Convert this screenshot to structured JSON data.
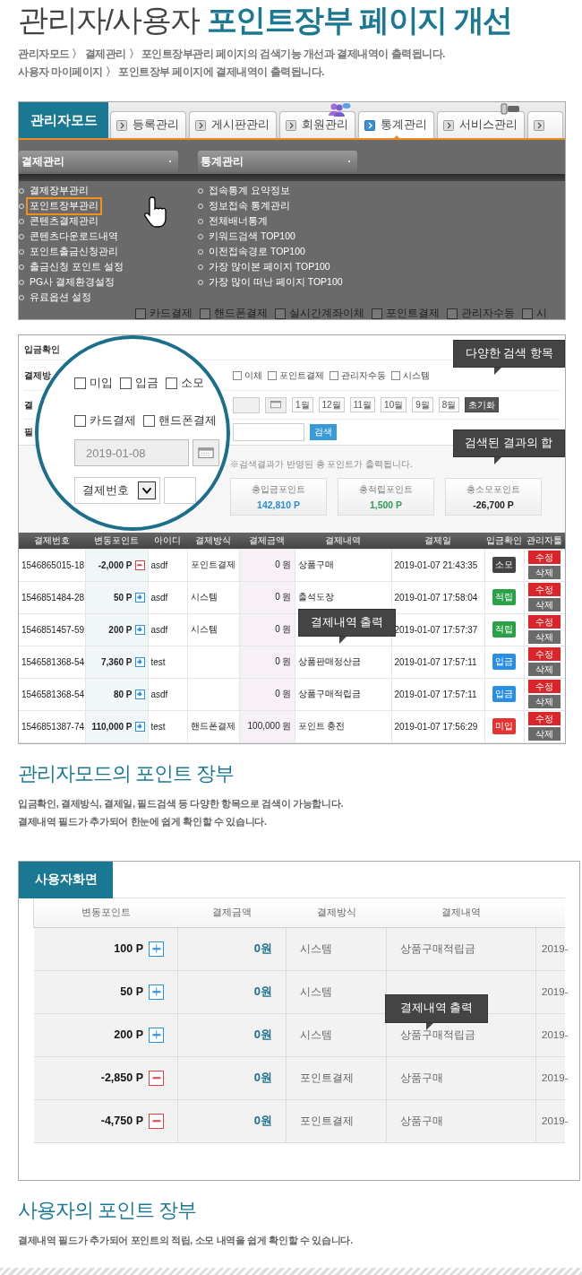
{
  "header": {
    "title_plain": "관리자/사용자",
    "title_highlight": "포인트장부 페이지 개선",
    "lines": [
      "관리자모드 〉  결제관리 〉 포인트장부관리 페이지의 검색기능 개선과 결제내역이 출력됩니다.",
      "사용자 마이페이지 〉 포인트장부 페이지에 결제내역이 출력됩니다."
    ]
  },
  "admin_menu_shot": {
    "badge": "관리자모드",
    "tabs": [
      {
        "label": "등록관리",
        "selected": false
      },
      {
        "label": "게시판관리",
        "selected": false
      },
      {
        "label": "회원관리",
        "selected": false
      },
      {
        "label": "통계관리",
        "selected": true
      },
      {
        "label": "서비스관리",
        "selected": false
      },
      {
        "selected": false
      }
    ],
    "menus": [
      {
        "title": "결제관리",
        "items": [
          {
            "label": "결제장부관리",
            "highlighted": false
          },
          {
            "label": "포인트장부관리",
            "highlighted": true
          },
          {
            "label": "콘텐츠결제관리",
            "highlighted": false
          },
          {
            "label": "콘텐츠다운로드내역",
            "highlighted": false
          },
          {
            "label": "포인트출금신청관리",
            "highlighted": false
          },
          {
            "label": "출금신청 포인트 설정",
            "highlighted": false
          },
          {
            "label": "PG사 결제환경설정",
            "highlighted": false
          },
          {
            "label": "유료옵션 설정",
            "highlighted": false
          }
        ]
      },
      {
        "title": "통계관리",
        "items": [
          {
            "label": "접속통계 요약정보",
            "highlighted": false
          },
          {
            "label": "정보접속 통계관리",
            "highlighted": false
          },
          {
            "label": "전체배너통계",
            "highlighted": false
          },
          {
            "label": "키워드검색 TOP100",
            "highlighted": false
          },
          {
            "label": "이전접속경로 TOP100",
            "highlighted": false
          },
          {
            "label": "가장 많이본 페이지 TOP100",
            "highlighted": false
          },
          {
            "label": "가장 많이 떠난 페이지 TOP100",
            "highlighted": false
          }
        ]
      }
    ],
    "background_checkboxes": [
      {
        "label": "카드결제",
        "checked": false
      },
      {
        "label": "핸드폰결제",
        "checked": false
      },
      {
        "label": "실시간계좌이체",
        "checked": false
      },
      {
        "label": "포인트결제",
        "checked": false
      },
      {
        "label": "관리자수동",
        "checked": false
      },
      {
        "label": "시",
        "checked": false
      }
    ]
  },
  "filter_shot": {
    "labels": [
      "입금확인",
      "결제방",
      "결",
      "필"
    ],
    "payment_checkboxes": [
      {
        "label": "이체",
        "checked": false
      },
      {
        "label": "포인트결제",
        "checked": false
      },
      {
        "label": "관리자수동",
        "checked": false
      },
      {
        "label": "시스템",
        "checked": false
      }
    ],
    "month_buttons": [
      {
        "label": "1월",
        "kind": "month"
      },
      {
        "label": "12월",
        "kind": "month"
      },
      {
        "label": "11월",
        "kind": "month"
      },
      {
        "label": "10월",
        "kind": "month"
      },
      {
        "label": "9월",
        "kind": "month"
      },
      {
        "label": "8월",
        "kind": "month"
      },
      {
        "label": "초기화",
        "kind": "reset"
      }
    ],
    "search_button": "검색",
    "note": "※검색결과가 반영된 총 포인트가 출력됩니다.",
    "totals": [
      {
        "label": "총입금포인트",
        "value": "142,810 P",
        "color": "#2a8fd8"
      },
      {
        "label": "총적립포인트",
        "value": "1,500 P",
        "color": "#2e9e5a"
      },
      {
        "label": "총소모포인트",
        "value": "-26,700 P",
        "color": "#222222"
      }
    ],
    "callouts": [
      "다양한 검색 항목",
      "검색된 결과의 합"
    ],
    "magnifier": {
      "status_checkboxes": [
        {
          "label": "미입",
          "checked": false
        },
        {
          "label": "입금",
          "checked": false
        },
        {
          "label": "소모",
          "checked": false
        }
      ],
      "method_checkboxes": [
        {
          "label": "카드결제",
          "checked": false
        },
        {
          "label": "핸드폰결제",
          "checked": false
        }
      ],
      "date": "2019-01-08",
      "select": "결제번호"
    }
  },
  "ledger_table": {
    "columns": [
      "결제번호",
      "변동포인트",
      "아이디",
      "결제방식",
      "결제금액",
      "결제내역",
      "결제일",
      "입금확인",
      "관리자툴"
    ],
    "rows": [
      {
        "id": "1546865015-18",
        "points": "-2,000 P",
        "negative": true,
        "user": "asdf",
        "method": "포인트결제",
        "amount": "0 원",
        "desc": "상품구매",
        "date": "2019-01-07 21:43:35",
        "status": "소모",
        "color": "#444444",
        "edit": "수정",
        "delete": "삭제"
      },
      {
        "id": "1546851484-28",
        "points": "50 P",
        "negative": false,
        "user": "asdf",
        "method": "시스템",
        "amount": "0 원",
        "desc": "출석도장",
        "date": "2019-01-07 17:58:04",
        "status": "적립",
        "color": "#2aa147",
        "edit": "수정",
        "delete": "삭제"
      },
      {
        "id": "1546851457-59",
        "points": "200 P",
        "negative": false,
        "user": "asdf",
        "method": "시스템",
        "amount": "0 원",
        "date": "2019-01-07 17:57:37",
        "status": "적립",
        "color": "#2aa147",
        "edit": "수정",
        "delete": "삭제"
      },
      {
        "id": "1546581368-54",
        "points": "7,360 P",
        "negative": false,
        "user": "test",
        "amount": "0 원",
        "desc": "상품판매정산금",
        "date": "2019-01-07 17:57:11",
        "status": "입금",
        "color": "#2a8fe0",
        "edit": "수정",
        "delete": "삭제"
      },
      {
        "id": "1546581368-54",
        "points": "80 P",
        "negative": false,
        "user": "asdf",
        "amount": "0 원",
        "desc": "상품구매적립금",
        "date": "2019-01-07 17:57:11",
        "status": "입금",
        "color": "#2a8fe0",
        "edit": "수정",
        "delete": "삭제"
      },
      {
        "id": "1546851387-74",
        "points": "110,000 P",
        "negative": false,
        "user": "test",
        "method": "핸드폰결제",
        "amount": "100,000 원",
        "desc": "포인트 충전",
        "date": "2019-01-07 17:56:29",
        "status": "미입",
        "color": "#e33333",
        "edit": "수정",
        "delete": "삭제"
      }
    ],
    "callout": "결제내역 출력"
  },
  "admin_caption": {
    "title": "관리자모드의 포인트 장부",
    "lines": [
      "입금확인, 결제방식, 결제일, 필드검색 등 다양한 항목으로 검색이 가능합니다.",
      "결제내역 필드가 추가되어 한눈에 쉽게 확인할 수 있습니다."
    ]
  },
  "user_shot": {
    "badge": "사용자화면",
    "columns": [
      "변동포인트",
      "결제금액",
      "결제방식",
      "결제내역"
    ],
    "rows": [
      {
        "points": "100 P",
        "negative": false,
        "amount": "0원",
        "method": "시스템",
        "desc": "상품구매적립금",
        "date": "2019-"
      },
      {
        "points": "50 P",
        "negative": false,
        "amount": "0원",
        "method": "시스템",
        "date": "2019-"
      },
      {
        "points": "200 P",
        "negative": false,
        "amount": "0원",
        "method": "시스템",
        "desc": "상품구매적립금",
        "date": "2019-"
      },
      {
        "points": "-2,850 P",
        "negative": true,
        "amount": "0원",
        "method": "포인트결제",
        "desc": "상품구매",
        "date": "2019-"
      },
      {
        "points": "-4,750 P",
        "negative": true,
        "amount": "0원",
        "method": "포인트결제",
        "desc": "상품구매",
        "date": "2019-"
      }
    ],
    "callout": "결제내역 출력"
  },
  "user_caption": {
    "title": "사용자의 포인트 장부",
    "lines": [
      "결제내역 필드가 추가되어 포인트의 적립, 소모 내역을 쉽게 확인할 수 있습니다."
    ]
  }
}
